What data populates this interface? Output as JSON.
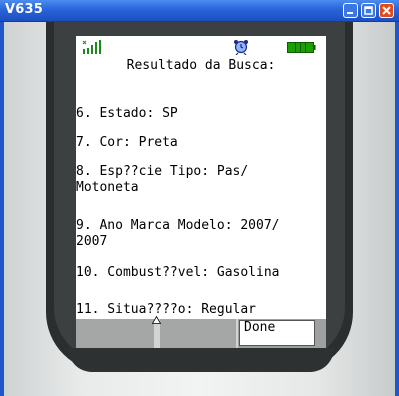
{
  "window": {
    "title": "V635"
  },
  "screen": {
    "title": "Resultado da Busca:",
    "items": [
      "6. Estado: SP",
      "7. Cor: Preta",
      "8. Esp??cie Tipo: Pas/\nMotoneta",
      "9. Ano Marca Modelo: 2007/\n2007",
      "10. Combust??vel: Gasolina",
      "11. Situa????o: Regular"
    ]
  },
  "softkeys": {
    "right_label": "Done"
  },
  "icons": {
    "signal": "signal-strength-icon",
    "alarm": "alarm-clock-icon",
    "battery": "battery-icon",
    "scroll": "scroll-up-arrow-icon"
  },
  "colors": {
    "titlebar": "#2a64d8",
    "battery": "#1aa000",
    "softkey_bar": "#a5a6a6"
  }
}
